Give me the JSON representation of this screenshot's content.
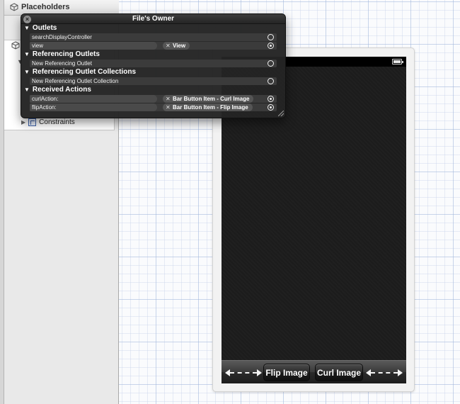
{
  "outline": {
    "header_title": "Placeholders",
    "constraints_label": "Constraints"
  },
  "hud": {
    "title": "File's Owner",
    "close_glyph": "×",
    "sections": {
      "outlets": "Outlets",
      "referencing_outlets": "Referencing Outlets",
      "referencing_outlet_collections": "Referencing Outlet Collections",
      "received_actions": "Received Actions"
    },
    "rows": {
      "search_display_controller": "searchDisplayController",
      "view": "view",
      "view_target": "View",
      "new_referencing_outlet": "New Referencing Outlet",
      "new_referencing_outlet_collection": "New Referencing Outlet Collection",
      "curl_action": "curlAction:",
      "curl_action_target": "Bar Button Item - Curl Image",
      "flip_action": "flipAction:",
      "flip_action_target": "Bar Button Item - Flip Image"
    }
  },
  "device": {
    "toolbar": {
      "flip_button": "Flip Image",
      "curl_button": "Curl Image"
    }
  },
  "colors": {
    "hud_background": "#242424",
    "screen_background": "#1c1c1c",
    "outline_background": "#e9e9e9"
  }
}
